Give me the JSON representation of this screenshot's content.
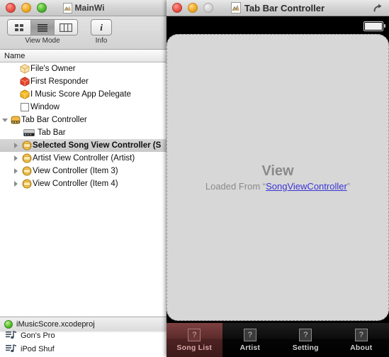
{
  "itunes_window": {
    "items": [
      {
        "icon": "music-note-icon",
        "label": "Gon's Pro"
      },
      {
        "icon": "music-note-icon",
        "label": "iPod Shuf"
      }
    ]
  },
  "document_window": {
    "title": "MainWi",
    "title_icon": "xib-document-icon",
    "traffic_lights": {
      "close": "close-button",
      "minimize": "minimize-button",
      "zoom": "zoom-button"
    },
    "toolbar": {
      "view_mode_label": "View Mode",
      "info_label": "Info",
      "info_glyph": "i",
      "segments": [
        {
          "name": "icon-view",
          "selected": false
        },
        {
          "name": "list-view",
          "selected": true
        },
        {
          "name": "column-view",
          "selected": false
        }
      ]
    },
    "column_header": "Name",
    "outline": [
      {
        "label": "File's Owner",
        "icon": "files-owner-icon",
        "indent": 1,
        "triangle": "none",
        "selected": false
      },
      {
        "label": "First Responder",
        "icon": "first-responder-icon",
        "indent": 1,
        "triangle": "none",
        "selected": false
      },
      {
        "label": "I Music Score App Delegate",
        "icon": "app-delegate-icon",
        "indent": 1,
        "triangle": "none",
        "selected": false
      },
      {
        "label": "Window",
        "icon": "window-icon",
        "indent": 1,
        "triangle": "none",
        "selected": false
      },
      {
        "label": "Tab Bar Controller",
        "icon": "tab-bar-controller-icon",
        "indent": 0,
        "triangle": "open",
        "selected": false
      },
      {
        "label": "Tab Bar",
        "icon": "tab-bar-icon",
        "indent": 2,
        "triangle": "none",
        "selected": false
      },
      {
        "label": "Selected Song View Controller (S",
        "icon": "view-controller-icon",
        "indent": 1,
        "triangle": "closed",
        "selected": true
      },
      {
        "label": "Artist View Controller (Artist)",
        "icon": "view-controller-icon",
        "indent": 1,
        "triangle": "closed",
        "selected": false
      },
      {
        "label": "View Controller (Item 3)",
        "icon": "view-controller-icon",
        "indent": 1,
        "triangle": "closed",
        "selected": false
      },
      {
        "label": "View Controller (Item 4)",
        "icon": "view-controller-icon",
        "indent": 1,
        "triangle": "closed",
        "selected": false
      }
    ],
    "status_bar": {
      "project_name": "iMusicScore.xcodeproj",
      "status_indicator": "green-status-dot"
    }
  },
  "simulator_window": {
    "title": "Tab Bar Controller",
    "title_icon": "xib-document-icon",
    "restore_icon": "restore-arrow-icon",
    "status_bar": {
      "battery_icon": "battery-icon"
    },
    "view": {
      "heading": "View",
      "subtitle_prefix": "Loaded From “",
      "link_text": "SongViewController",
      "subtitle_suffix": "”"
    },
    "tab_bar": {
      "items": [
        {
          "label": "Song List",
          "icon": "placeholder-question-icon",
          "glyph": "?",
          "active": true
        },
        {
          "label": "Artist",
          "icon": "placeholder-question-icon",
          "glyph": "?",
          "active": false
        },
        {
          "label": "Setting",
          "icon": "placeholder-question-icon",
          "glyph": "?",
          "active": false
        },
        {
          "label": "About",
          "icon": "placeholder-question-icon",
          "glyph": "?",
          "active": false
        }
      ]
    }
  },
  "colors": {
    "accent_link": "#3a35d6",
    "tab_active": "#5c2b2b",
    "view_bg": "#d7d7d7",
    "status_green": "#5fc731"
  }
}
